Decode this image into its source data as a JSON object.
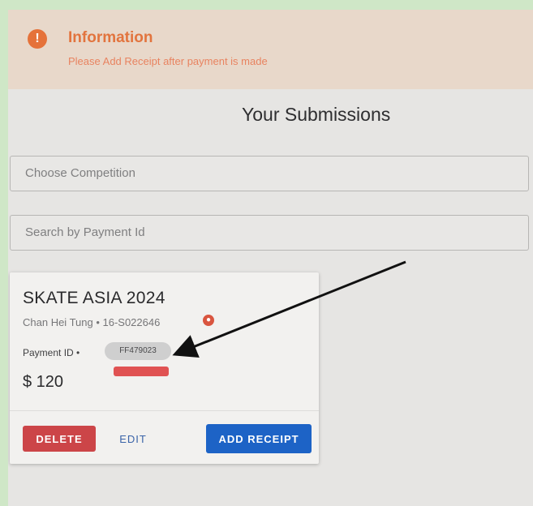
{
  "info": {
    "icon": "!",
    "title": "Information",
    "message": "Please Add Receipt after payment is made"
  },
  "page": {
    "title": "Your Submissions"
  },
  "filters": {
    "competition_placeholder": "Choose Competition",
    "payment_search_placeholder": "Search by Payment Id"
  },
  "card": {
    "title": "SKATE ASIA 2024",
    "subtitle": "Chan Hei Tung • 16-S022646",
    "user_icon": "user-icon",
    "payment_label": "Payment ID •",
    "payment_id": "FF479023",
    "amount": "$ 120",
    "actions": {
      "delete": "DELETE",
      "edit": "EDIT",
      "add_receipt": "ADD RECEIPT"
    }
  },
  "colors": {
    "info_accent": "#e5723a",
    "delete": "#cc4548",
    "primary": "#1d63c6",
    "link": "#3a63a8",
    "annotation_red": "#e05252"
  }
}
